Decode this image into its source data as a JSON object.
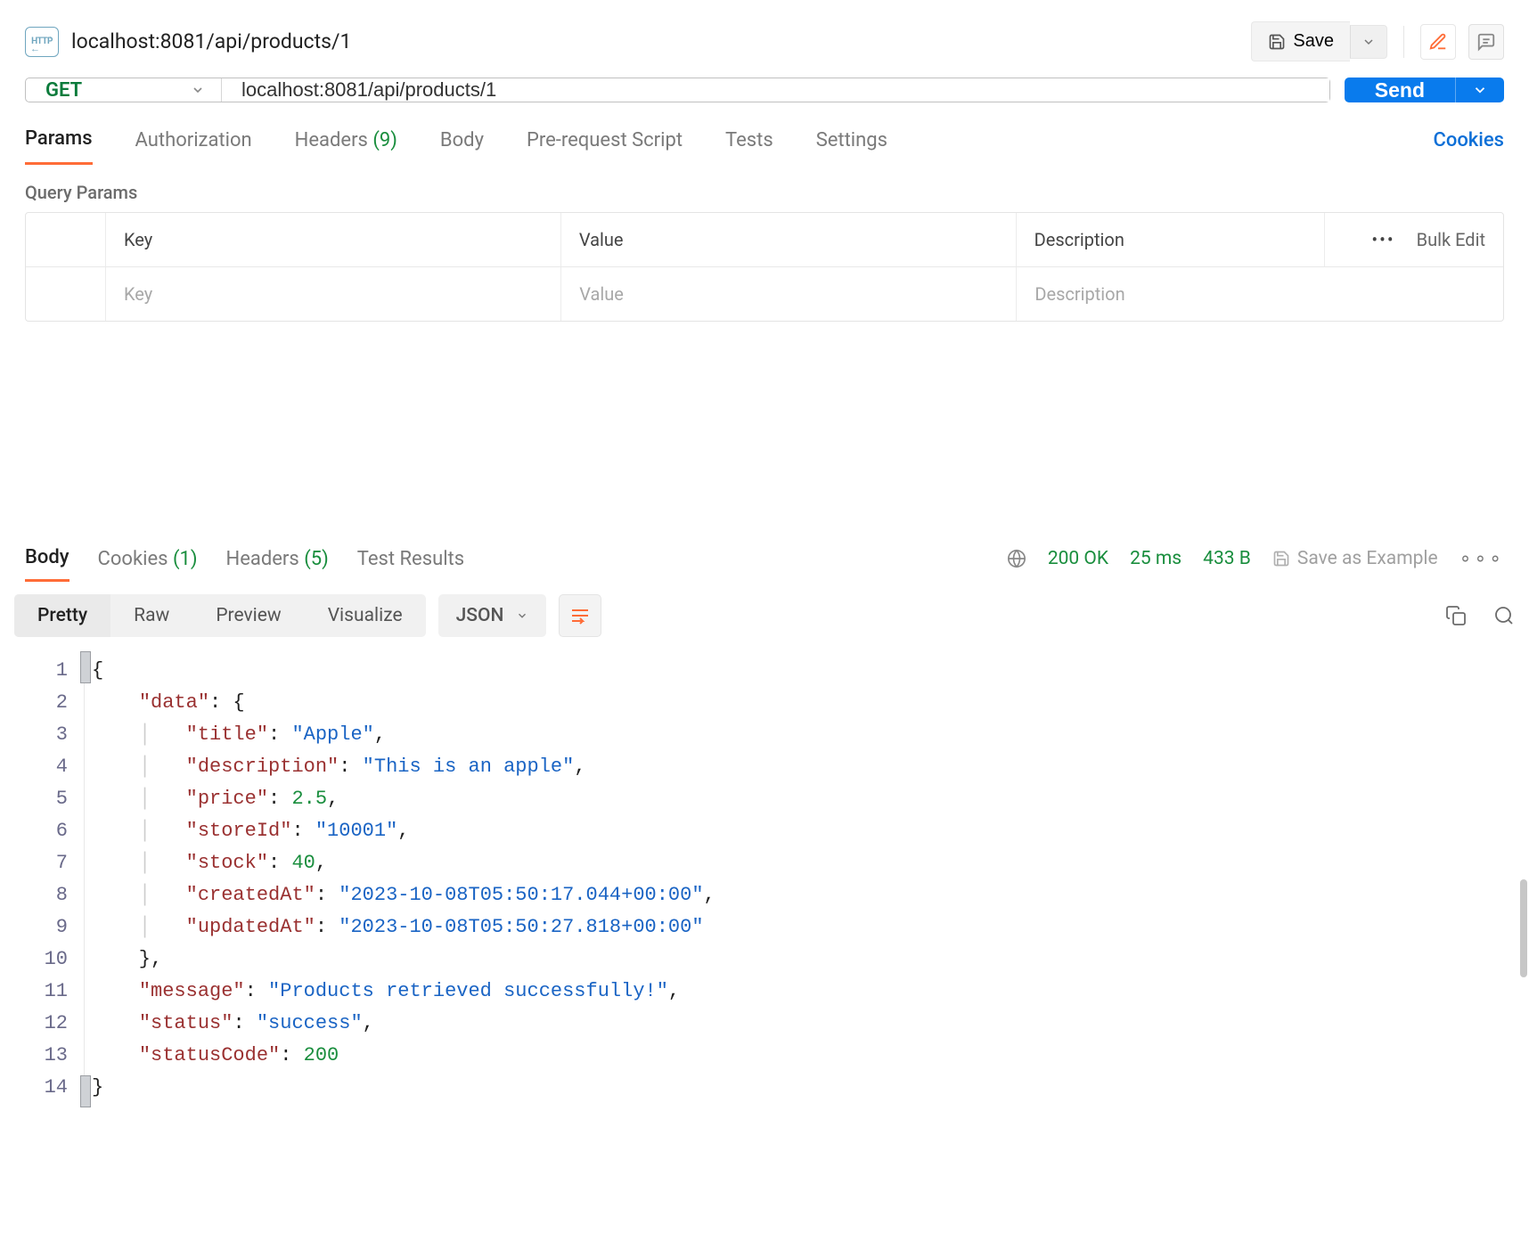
{
  "header": {
    "title": "localhost:8081/api/products/1",
    "save_label": "Save"
  },
  "request": {
    "method": "GET",
    "url": "localhost:8081/api/products/1",
    "send_label": "Send"
  },
  "request_tabs": {
    "params": "Params",
    "auth": "Authorization",
    "headers": "Headers",
    "headers_count": "(9)",
    "body": "Body",
    "prerequest": "Pre-request Script",
    "tests": "Tests",
    "settings": "Settings",
    "cookies": "Cookies"
  },
  "query_params": {
    "section": "Query Params",
    "key_header": "Key",
    "value_header": "Value",
    "desc_header": "Description",
    "bulk_edit": "Bulk Edit",
    "key_placeholder": "Key",
    "value_placeholder": "Value",
    "desc_placeholder": "Description"
  },
  "response_tabs": {
    "body": "Body",
    "cookies": "Cookies",
    "cookies_count": "(1)",
    "headers": "Headers",
    "headers_count": "(5)",
    "test_results": "Test Results"
  },
  "response_meta": {
    "status": "200 OK",
    "time": "25 ms",
    "size": "433 B",
    "save_example": "Save as Example"
  },
  "viewmode": {
    "pretty": "Pretty",
    "raw": "Raw",
    "preview": "Preview",
    "visualize": "Visualize",
    "format": "JSON"
  },
  "json_lines": [
    "{",
    "    \"data\": {",
    "        \"title\": \"Apple\",",
    "        \"description\": \"This is an apple\",",
    "        \"price\": 2.5,",
    "        \"storeId\": \"10001\",",
    "        \"stock\": 40,",
    "        \"createdAt\": \"2023-10-08T05:50:17.044+00:00\",",
    "        \"updatedAt\": \"2023-10-08T05:50:27.818+00:00\"",
    "    },",
    "    \"message\": \"Products retrieved successfully!\",",
    "    \"status\": \"success\",",
    "    \"statusCode\": 200",
    "}"
  ],
  "json_payload": {
    "data": {
      "title": "Apple",
      "description": "This is an apple",
      "price": 2.5,
      "storeId": "10001",
      "stock": 40,
      "createdAt": "2023-10-08T05:50:17.044+00:00",
      "updatedAt": "2023-10-08T05:50:27.818+00:00"
    },
    "message": "Products retrieved successfully!",
    "status": "success",
    "statusCode": 200
  },
  "colors": {
    "accent_orange": "#ff6c37",
    "primary_blue": "#097bed",
    "success_green": "#1a8e3e"
  }
}
